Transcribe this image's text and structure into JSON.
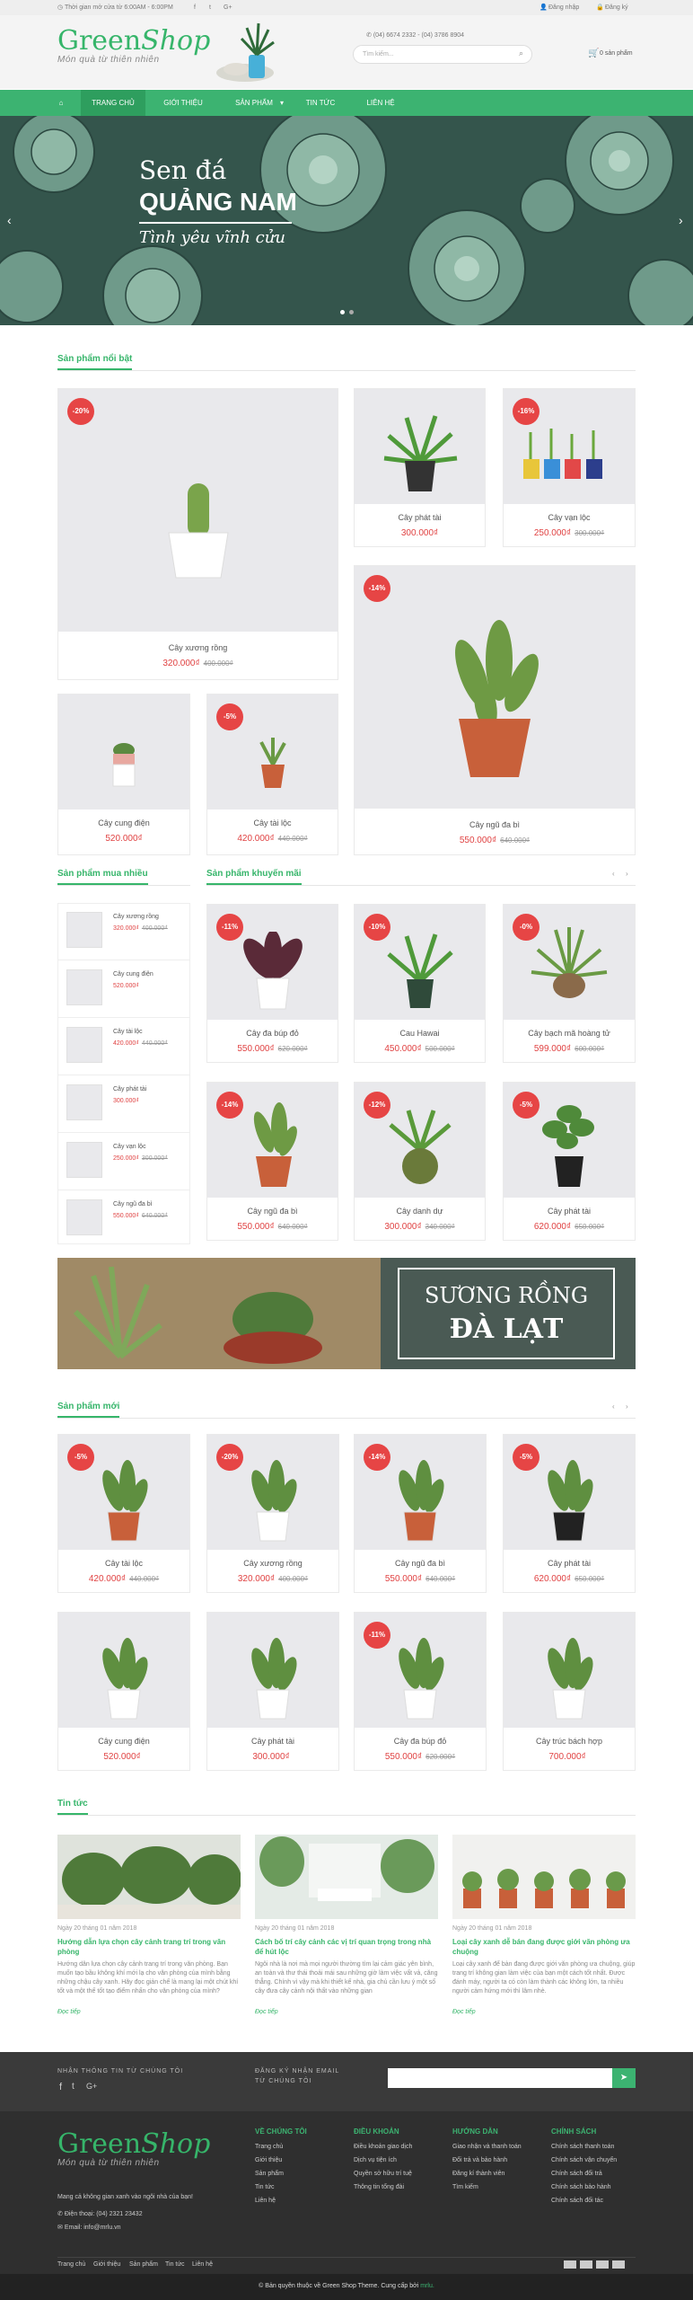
{
  "topbar": {
    "hours": "Thời gian mở cửa từ 6:00AM - 6:00PM",
    "social": [
      "f",
      "t",
      "G+"
    ],
    "login": "Đăng nhập",
    "register": "Đăng ký"
  },
  "header": {
    "logo_main": "Green",
    "logo_script": "Shop",
    "logo_sub": "Món quà từ thiên nhiên",
    "phones": "(04) 6674 2332 - (04) 3786 8904",
    "search_placeholder": "Tìm kiếm...",
    "cart": "0 sản phẩm"
  },
  "nav": {
    "items": [
      "TRANG CHỦ",
      "GIỚI THIỆU",
      "SẢN PHẨM",
      "TIN TỨC",
      "LIÊN HỆ"
    ]
  },
  "slider": {
    "line1": "Sen đá",
    "line2": "QUẢNG NAM",
    "line3": "Tình yêu vĩnh cửu"
  },
  "featured": {
    "title": "Sản phẩm nổi bật",
    "items": [
      {
        "name": "Cây xương rồng",
        "price": "320.000₫",
        "old": "400.000₫",
        "badge": "-20%"
      },
      {
        "name": "Cây phát tài",
        "price": "300.000₫",
        "old": "",
        "badge": ""
      },
      {
        "name": "Cây vạn lộc",
        "price": "250.000₫",
        "old": "300.000₫",
        "badge": "-16%"
      },
      {
        "name": "Cây ngũ đa bì",
        "price": "550.000₫",
        "old": "640.000₫",
        "badge": "-14%"
      },
      {
        "name": "Cây cung điện",
        "price": "520.000₫",
        "old": "",
        "badge": ""
      },
      {
        "name": "Cây tài lộc",
        "price": "420.000₫",
        "old": "440.000₫",
        "badge": "-5%"
      }
    ]
  },
  "bestsellers": {
    "title": "Sản phẩm mua nhiều",
    "items": [
      {
        "name": "Cây xương rồng",
        "price": "320.000₫",
        "old": "400.000₫"
      },
      {
        "name": "Cây cung điện",
        "price": "520.000₫",
        "old": ""
      },
      {
        "name": "Cây tài lộc",
        "price": "420.000₫",
        "old": "440.000₫"
      },
      {
        "name": "Cây phát tài",
        "price": "300.000₫",
        "old": ""
      },
      {
        "name": "Cây vạn lộc",
        "price": "250.000₫",
        "old": "300.000₫"
      },
      {
        "name": "Cây ngũ đa bì",
        "price": "550.000₫",
        "old": "640.000₫"
      }
    ]
  },
  "promo": {
    "title": "Sản phẩm khuyến mãi",
    "items": [
      {
        "name": "Cây đa búp đỏ",
        "price": "550.000₫",
        "old": "620.000₫",
        "badge": "-11%"
      },
      {
        "name": "Cau Hawai",
        "price": "450.000₫",
        "old": "500.000₫",
        "badge": "-10%"
      },
      {
        "name": "Cây bạch mã hoàng tử",
        "price": "599.000₫",
        "old": "600.000₫",
        "badge": "-0%"
      },
      {
        "name": "Cây ngũ đa bì",
        "price": "550.000₫",
        "old": "640.000₫",
        "badge": "-14%"
      },
      {
        "name": "Cây danh dự",
        "price": "300.000₫",
        "old": "340.000₫",
        "badge": "-12%"
      },
      {
        "name": "Cây phát tài",
        "price": "620.000₫",
        "old": "650.000₫",
        "badge": "-5%"
      }
    ]
  },
  "banner": {
    "line1": "SƯƠNG RỒNG",
    "line2": "ĐÀ LẠT"
  },
  "newproducts": {
    "title": "Sản phẩm mới",
    "items": [
      {
        "name": "Cây tài lộc",
        "price": "420.000₫",
        "old": "440.000₫",
        "badge": "-5%"
      },
      {
        "name": "Cây xương rồng",
        "price": "320.000₫",
        "old": "400.000₫",
        "badge": "-20%"
      },
      {
        "name": "Cây ngũ đa bì",
        "price": "550.000₫",
        "old": "640.000₫",
        "badge": "-14%"
      },
      {
        "name": "Cây phát tài",
        "price": "620.000₫",
        "old": "650.000₫",
        "badge": "-5%"
      },
      {
        "name": "Cây cung điện",
        "price": "520.000₫",
        "old": "",
        "badge": ""
      },
      {
        "name": "Cây phát tài",
        "price": "300.000₫",
        "old": "",
        "badge": ""
      },
      {
        "name": "Cây đa búp đỏ",
        "price": "550.000₫",
        "old": "620.000₫",
        "badge": "-11%"
      },
      {
        "name": "Cây trúc bách hợp",
        "price": "700.000₫",
        "old": "",
        "badge": ""
      }
    ]
  },
  "news": {
    "title": "Tin tức",
    "items": [
      {
        "date": "Ngày 20 tháng 01 năm 2018",
        "title": "Hướng dẫn lựa chọn cây cảnh trang trí trong văn phòng",
        "text": "Hướng dẫn lựa chọn cây cảnh trang trí trong văn phòng. Bạn muốn tạo bầu không khí mới lạ cho văn phòng của mình bằng những chậu cây xanh. Hãy đọc giản chế là mang lại một chút khí tốt và một thế tốt tạo điểm nhấn cho văn phòng của mình?",
        "more": "Đọc tiếp"
      },
      {
        "date": "Ngày 20 tháng 01 năm 2018",
        "title": "Cách bố trí cây cảnh các vị trí quan trọng trong nhà để hút lộc",
        "text": "Ngôi nhà là nơi mà mọi người thường tìm lại cảm giác yên bình, an toàn và thư thái thoải mái sau những giờ làm việc vất vả, căng thẳng. Chính vì vậy mà khi thiết kế nhà, gia chủ cần lưu ý một số cây đưa cây cảnh nội thất vào những gian",
        "more": "Đọc tiếp"
      },
      {
        "date": "Ngày 20 tháng 01 năm 2018",
        "title": "Loại cây xanh dễ bán đang được giới văn phòng ưa chuộng",
        "text": "Loại cây xanh để bàn đang được giới văn phòng ưa chuộng, giúp trang trí không gian làm việc của bạn một cách tốt nhất. Được đánh máy, người ta có còn làm thành các không lớn, ta nhiều người cảm hứng mới thì lâm nhè.",
        "more": "Đọc tiếp"
      }
    ]
  },
  "newsletter": {
    "label1": "NHẬN THÔNG TIN TỪ CHÚNG TÔI",
    "label2": "ĐĂNG KÝ NHẬN EMAIL",
    "label3": "TỪ CHÚNG TÔI"
  },
  "footer": {
    "desc": "Mang cả không gian xanh vào ngôi nhà của bạn!",
    "phone": "Điện thoại: (04) 2321 23432",
    "email": "Email: info@mrlu.vn",
    "cols": [
      {
        "title": "VỀ CHÚNG TÔI",
        "links": [
          "Trang chủ",
          "Giới thiệu",
          "Sản phẩm",
          "Tin tức",
          "Liên hệ"
        ]
      },
      {
        "title": "ĐIỀU KHOẢN",
        "links": [
          "Điều khoản giao dịch",
          "Dịch vụ tiện ích",
          "Quyền sở hữu trí tuệ",
          "Thông tin tổng đài"
        ]
      },
      {
        "title": "HƯỚNG DẪN",
        "links": [
          "Giao nhận và thanh toán",
          "Đổi trả và bảo hành",
          "Đăng kí thành viên",
          "Tìm kiếm"
        ]
      },
      {
        "title": "CHÍNH SÁCH",
        "links": [
          "Chính sách thanh toán",
          "Chính sách vận chuyển",
          "Chính sách đổi trả",
          "Chính sách bảo hành",
          "Chính sách đối tác"
        ]
      }
    ],
    "bottom_links": [
      "Trang chủ",
      "Giới thiệu",
      "Sản phẩm",
      "Tin tức",
      "Liên hệ"
    ],
    "copyright": "© Bản quyền thuộc về Green Shop Theme. Cung cấp bởi",
    "copyright_brand": "mrlu."
  },
  "colors": {
    "accent": "#3cb371",
    "sale": "#e64545",
    "footer": "#2f2f2f"
  }
}
